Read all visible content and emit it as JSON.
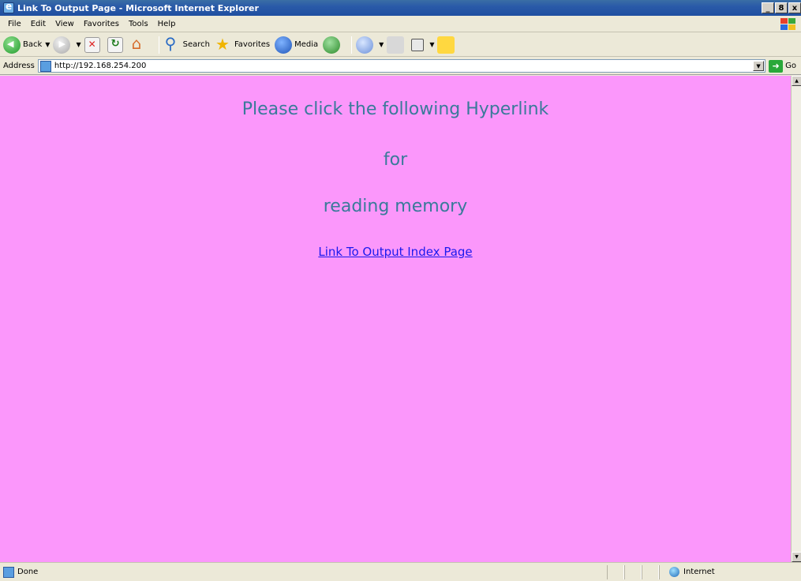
{
  "window": {
    "title": "Link To Output Page - Microsoft Internet Explorer",
    "min": "_",
    "max": "8",
    "close": "x"
  },
  "menu": {
    "items": [
      "File",
      "Edit",
      "View",
      "Favorites",
      "Tools",
      "Help"
    ]
  },
  "toolbar": {
    "back": "Back",
    "search": "Search",
    "favorites": "Favorites",
    "media": "Media"
  },
  "address": {
    "label": "Address",
    "url": "http://192.168.254.200",
    "go": "Go"
  },
  "content": {
    "line1": "Please click the following Hyperlink",
    "line2": "for",
    "line3": "reading memory",
    "link": "Link To Output Index Page",
    "text_color": "#3a7a9a",
    "background": "#fb97fb"
  },
  "status": {
    "text": "Done",
    "zone": "Internet"
  }
}
